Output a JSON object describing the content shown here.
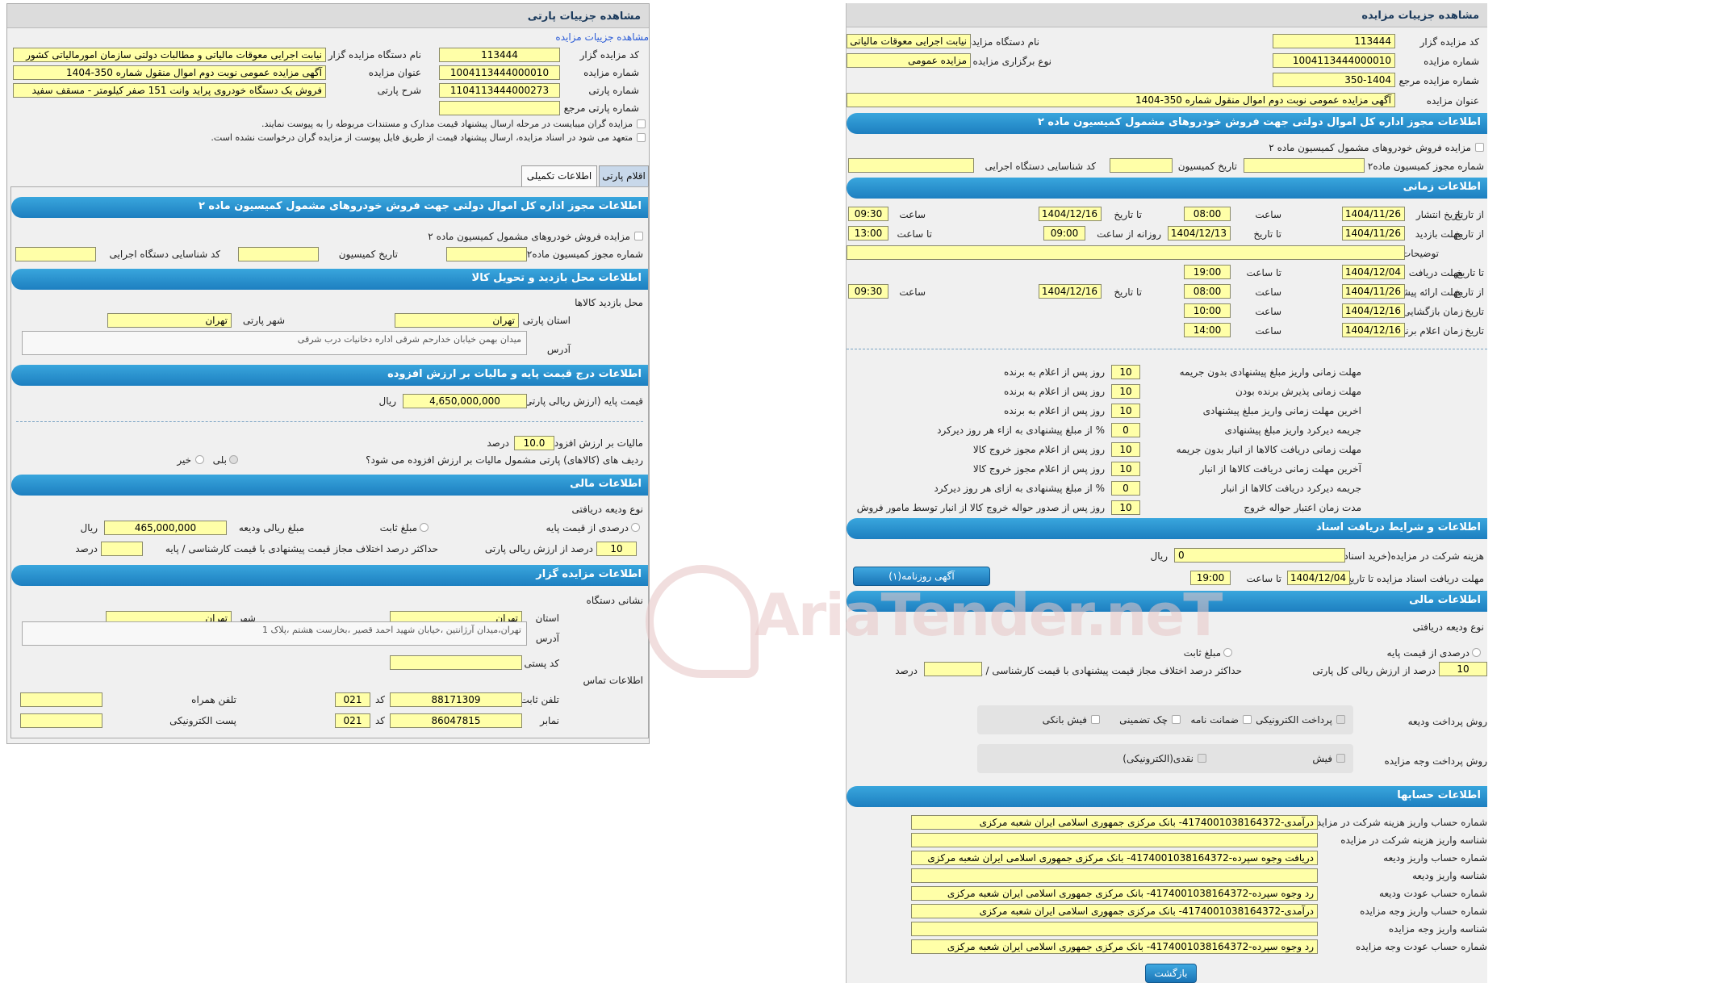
{
  "left": {
    "title": "مشاهده جزییات پارتی",
    "link": "مشاهده جزییات مزایده",
    "f_code_lbl": "کد مزایده گزار",
    "f_code_val": "113444",
    "f_org_lbl": "نام دستگاه مزایده گزار",
    "f_org_val": "نیابت اجرایی معوقات مالیاتی و مطالبات دولتی سازمان امورمالیاتی کشور",
    "f_num_lbl": "شماره مزایده",
    "f_num_val": "1004113444000010",
    "f_title_lbl": "عنوان مزایده",
    "f_title_val": "آگهی مزایده عمومی نوبت دوم اموال منقول شماره 350-1404",
    "f_party_lbl": "شماره پارتی",
    "f_party_val": "1104113444000273",
    "f_desc_lbl": "شرح پارتی",
    "f_desc_val": "فروش یک دستگاه خودروی پراید وانت 151 صفر کیلومتر - مسقف سفید",
    "f_ref_lbl": "شماره پارتی مرجع",
    "chk1": "مزایده گران میبایست در مرحله ارسال پیشنهاد قیمت مدارک و مستندات مربوطه را به پیوست نمایند.",
    "chk2": "متعهد می شود در اسناد مزایده، ارسال پیشنهاد قیمت از طریق فایل پیوست از مزایده گران درخواست نشده است.",
    "tab1": "اقلام پارتی",
    "tab2": "اطلاعات تکمیلی",
    "h_permit": "اطلاعات مجوز اداره کل اموال دولتی جهت فروش خودروهای مشمول کمیسیون ماده ۲",
    "permit_chk": "مزایده فروش خودروهای مشمول کمیسیون ماده ۲",
    "permit_num": "شماره مجوز کمیسیون ماده۲",
    "permit_date": "تاریخ کمیسیون",
    "permit_id": "کد شناسایی دستگاه اجرایی",
    "h_visit": "اطلاعات محل بازدید و تحویل کالا",
    "visit_place": "محل بازدید کالاها",
    "prov_lbl": "استان پارتی",
    "prov_val": "تهران",
    "city_lbl": "شهر پارتی",
    "city_val": "تهران",
    "addr_lbl": "آدرس",
    "addr_val": "میدان بهمن خیابان خدارحم شرقی اداره دخانیات درب شرقی",
    "h_price": "اطلاعات درج قیمت پایه و مالیات بر ارزش افزوده",
    "base_lbl": "قیمت پایه (ارزش ریالی پارتی)",
    "base_val": "4,650,000,000",
    "rial": "ریال",
    "vat_lbl": "مالیات بر ارزش افزوده",
    "vat_val": "10.0",
    "percent": "درصد",
    "vat_q": "ردیف های (کالاهای) پارتی مشمول مالیات بر ارزش افزوده می شود؟",
    "yes": "بلی",
    "no": "خیر",
    "h_fin": "اطلاعات مالی",
    "dep_type": "نوع ودیعه دریافتی",
    "dep_pct": "درصدی از قیمت پایه",
    "dep_fixed": "مبلغ ثابت",
    "dep_amount_lbl": "مبلغ ریالی ودیعه",
    "dep_amount_val": "465,000,000",
    "dep_pct_val": "10",
    "dep_pct_lbl": "درصد از ارزش ریالی پارتی",
    "max_diff": "حداکثر درصد اختلاف مجاز قیمت پیشنهادی با قیمت کارشناسی / پایه",
    "h_seller": "اطلاعات مزایده گزار",
    "org_addr": "نشانی دستگاه",
    "s_prov_lbl": "استان",
    "s_prov_val": "تهران",
    "s_city_lbl": "شهر",
    "s_city_val": "تهران",
    "s_addr_val": "تهران،میدان آرژانتین ،خیابان شهید احمد قصیر ،بخارست هشتم ،پلاک 1",
    "postal": "کد پستی",
    "contact": "اطلاعات تماس",
    "phone_lbl": "تلفن ثابت",
    "phone_val": "88171309",
    "code_lbl": "کد",
    "code_val": "021",
    "mobile_lbl": "تلفن همراه",
    "fax_lbl": "نمابر",
    "fax_val": "86047815",
    "fax_code": "021",
    "email_lbl": "پست الکترونیکی"
  },
  "right": {
    "title": "مشاهده جزییات مزایده",
    "code_lbl": "کد مزایده گزار",
    "code_val": "113444",
    "org_lbl": "نام دستگاه مزایده گزار",
    "org_val": "نیابت اجرایی معوقات مالیاتی",
    "num_lbl": "شماره مزایده",
    "num_val": "1004113444000010",
    "type_lbl": "نوع برگزاری مزایده",
    "type_val": "مزایده عمومی",
    "ref_lbl": "شماره مزایده مرجع",
    "ref_val": "350-1404",
    "t_lbl": "عنوان مزایده",
    "t_val": "آگهی مزایده عمومی نوبت دوم اموال منقول شماره 350-1404",
    "h_permit": "اطلاعات مجوز اداره کل اموال دولتی جهت فروش خودروهای مشمول کمیسیون ماده ۲",
    "permit_chk": "مزایده فروش خودروهای مشمول کمیسیون ماده ۲",
    "permit_num": "شماره مجوز کمیسیون ماده۲",
    "permit_date": "تاریخ کمیسیون",
    "permit_id": "کد شناسایی دستگاه اجرایی",
    "h_time": "اطلاعات زمانی",
    "pub": "تاریخ انتشار",
    "from_date": "از تاریخ",
    "to_date": "تا تاریخ",
    "hour": "ساعت",
    "to_hour": "تا ساعت",
    "daily": "روزانه از ساعت",
    "visit": "مهلت بازدید",
    "desc": "توضیحات",
    "doc": "مهلت دریافت اسناد",
    "offer": "مهلت ارائه پیشنهاد",
    "open": "زمان بازگشایی",
    "date": "تاریخ",
    "winner": "زمان اعلام برنده",
    "d_pub_from": "1404/11/26",
    "d_pub_from_h": "08:00",
    "d_pub_to": "1404/12/16",
    "d_pub_to_h": "09:30",
    "d_visit_from": "1404/11/26",
    "d_visit_to": "1404/12/13",
    "d_visit_daily": "09:00",
    "d_visit_to_h": "13:00",
    "d_doc": "1404/12/04",
    "d_doc_h": "19:00",
    "d_offer_from": "1404/11/26",
    "d_offer_from_h": "08:00",
    "d_offer_to": "1404/12/16",
    "d_offer_to_h": "09:30",
    "d_open": "1404/12/16",
    "d_open_h": "10:00",
    "d_win": "1404/12/16",
    "d_win_h": "14:00",
    "rows": [
      {
        "lbl": "مهلت زمانی واریز مبلغ پیشنهادی بدون جریمه",
        "val": "10",
        "unit": "روز پس از اعلام به برنده"
      },
      {
        "lbl": "مهلت زمانی پذیرش برنده بودن",
        "val": "10",
        "unit": "روز پس از اعلام به برنده"
      },
      {
        "lbl": "اخرین مهلت زمانی واریز مبلغ پیشنهادی",
        "val": "10",
        "unit": "روز پس از اعلام به برنده"
      },
      {
        "lbl": "جریمه دیرکرد واریز مبلغ پیشنهادی",
        "val": "0",
        "unit": "% از مبلغ پیشنهادی به ازاء هر روز دیرکرد"
      },
      {
        "lbl": "مهلت زمانی دریافت کالاها از انبار بدون جریمه",
        "val": "10",
        "unit": "روز پس از اعلام مجوز خروج کالا"
      },
      {
        "lbl": "آخرین مهلت زمانی دریافت کالاها از انبار",
        "val": "10",
        "unit": "روز پس از اعلام مجوز خروج کالا"
      },
      {
        "lbl": "جریمه دیرکرد دریافت کالاها از انبار",
        "val": "0",
        "unit": "% از مبلغ پیشنهادی به ازای هر روز دیرکرد"
      },
      {
        "lbl": "مدت زمان اعتبار حواله خروج",
        "val": "10",
        "unit": "روز پس از صدور حواله خروج کالا از انبار توسط مامور فروش"
      }
    ],
    "h_docs": "اطلاعات و شرایط دریافت اسناد",
    "fee_lbl": "هزینه شرکت در مزایده(خرید اسناد)",
    "fee_val": "0",
    "rial": "ریال",
    "dl_lbl": "مهلت دریافت اسناد مزایده تا تاریخ",
    "dl_date": "1404/12/04",
    "dl_h_lbl": "تا ساعت",
    "dl_h": "19:00",
    "news_btn": "آگهی روزنامه(۱)",
    "h_fin": "اطلاعات مالی",
    "dep_type": "نوع ودیعه دریافتی",
    "dep_pct": "درصدی از قیمت پایه",
    "dep_fixed": "مبلغ ثابت",
    "dep_pct_val": "10",
    "dep_pct_lbl": "درصد از ارزش ریالی کل پارتی",
    "max_diff": "حداکثر درصد اختلاف مجاز قیمت پیشنهادی با قیمت کارشناسی / پایه",
    "percent": "درصد",
    "pay_dep": "روش پرداخت ودیعه",
    "pay_e": "پرداخت الکترونیکی",
    "pay_g": "ضمانت نامه",
    "pay_c": "چک تضمینی",
    "pay_b": "فیش بانکی",
    "pay_amt": "روش پرداخت وجه مزایده",
    "pay_f": "فیش",
    "pay_cash": "نقدی(الکترونیکی)",
    "h_acc": "اطلاعات حسابها",
    "acc": [
      {
        "lbl": "شماره حساب واریز هزینه شرکت در مزایده",
        "val": "درآمدی-4174001038164372- بانک مرکزی جمهوری اسلامی ایران شعبه مرکزی"
      },
      {
        "lbl": "شناسه واریز هزینه شرکت در مزایده",
        "val": ""
      },
      {
        "lbl": "شماره حساب واریز ودیعه",
        "val": "دریافت وجوه سپرده-4174001038164372- بانک مرکزی جمهوری اسلامی ایران شعبه مرکزی"
      },
      {
        "lbl": "شناسه واریز ودیعه",
        "val": ""
      },
      {
        "lbl": "شماره حساب عودت ودیعه",
        "val": "رد وجوه سپرده-4174001038164372- بانک مرکزی جمهوری اسلامی ایران شعبه مرکزی"
      },
      {
        "lbl": "شماره حساب واریز وجه مزایده",
        "val": "درآمدی-4174001038164372- بانک مرکزی جمهوری اسلامی ایران شعبه مرکزی"
      },
      {
        "lbl": "شناسه واریز وجه مزایده",
        "val": ""
      },
      {
        "lbl": "شماره حساب عودت وجه مزایده",
        "val": "رد وجوه سپرده-4174001038164372- بانک مرکزی جمهوری اسلامی ایران شعبه مرکزی"
      }
    ],
    "back_btn": "بازگشت"
  },
  "watermark": "AriaTender.neT"
}
